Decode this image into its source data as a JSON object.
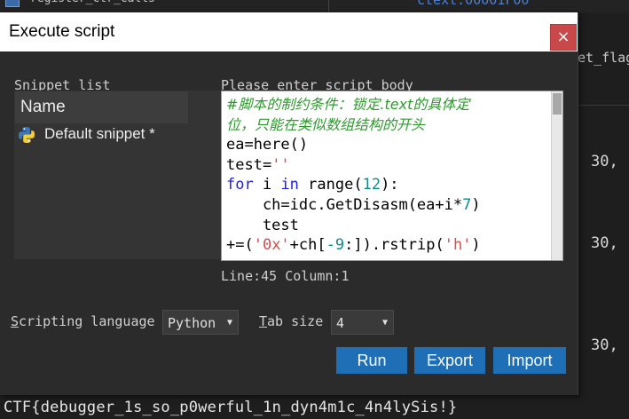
{
  "background": {
    "top_left_text": "register_ctr_calls",
    "top_right_text": "ctext:00001F00",
    "right_fragment": "et_flag",
    "right_numbers": [
      "30,",
      "30,",
      "30,"
    ],
    "ctf_output": "CTF{debugger_1s_so_p0werful_1n_dyn4m1c_4n4lySis!}"
  },
  "dialog": {
    "title": "Execute script",
    "close_glyph": "×",
    "snippet_list_label_prefix": "S",
    "snippet_list_label_hot": "n",
    "snippet_list_label_rest": "ippet list",
    "list_header": "Name",
    "snippet_item": "Default snippet *",
    "script_body_label_prefix": "Please enter script ",
    "script_body_label_hot": "b",
    "script_body_label_rest": "ody",
    "code": {
      "comment1": "#脚本的制约条件：锁定.text的具体定",
      "comment2": "位，只能在类似数组结构的开头",
      "l3": "ea=here()",
      "l4a": "test=",
      "l4b": "''",
      "l5a": "for",
      "l5b": " i ",
      "l5c": "in",
      "l5d": " range(",
      "l5e": "12",
      "l5f": "):",
      "l6a": "    ch=idc.GetDisasm(ea+i*",
      "l6b": "7",
      "l6c": ")",
      "l7": "    test",
      "l8a": "+=(",
      "l8b": "'0x'",
      "l8c": "+ch[",
      "l8d": "-9",
      "l8e": ":]).rstrip(",
      "l8f": "'h'",
      "l8g": ")"
    },
    "status": "Line:45 Column:1",
    "scripting_language_label_hot": "S",
    "scripting_language_label_rest": "cripting language",
    "scripting_language_value": "Python",
    "tab_size_label_hot": "T",
    "tab_size_label_rest": "ab size",
    "tab_size_value": "4",
    "buttons": {
      "run": "Run",
      "export": "Export",
      "import": "Import"
    }
  },
  "colors": {
    "button": "#1e6fb6",
    "close": "#c9484a",
    "comment": "#2e9a2e",
    "keyword": "#2020e0",
    "string": "#d05050",
    "number": "#0e8c8c"
  }
}
